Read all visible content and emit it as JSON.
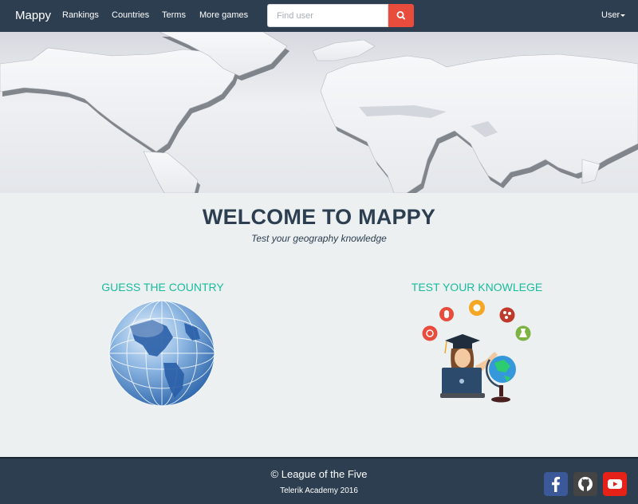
{
  "navbar": {
    "brand": "Mappy",
    "links": [
      "Rankings",
      "Countries",
      "Terms",
      "More games"
    ],
    "search": {
      "placeholder": "Find user",
      "value": ""
    },
    "search_button_icon": "search-icon",
    "user_menu": "User"
  },
  "welcome": {
    "title": "WELCOME TO MAPPY",
    "subtitle": "Test your geography knowledge"
  },
  "features": {
    "guess": {
      "title": "GUESS THE COUNTRY",
      "icon": "globe-icon"
    },
    "test": {
      "title": "TEST YOUR KNOWLEGE",
      "icon": "student-illustration"
    }
  },
  "footer": {
    "copyright": "© League of the Five",
    "subtitle": "Telerik Academy 2016",
    "social": [
      "facebook-icon",
      "github-icon",
      "youtube-icon"
    ]
  },
  "colors": {
    "navbar_bg": "#2c3e50",
    "page_bg": "#ecf0f1",
    "accent_red": "#e74c3c",
    "accent_teal": "#18bc9c",
    "facebook": "#3b5998",
    "github": "#444444",
    "youtube": "#e62117"
  }
}
